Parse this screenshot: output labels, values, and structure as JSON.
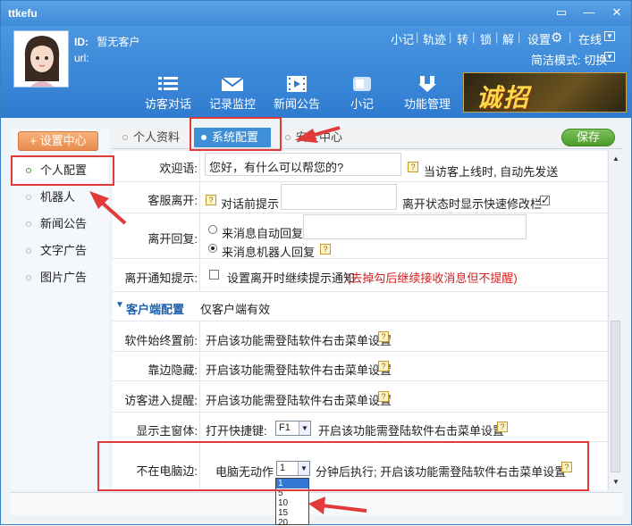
{
  "window": {
    "title": "ttkefu",
    "controls": [
      "▭",
      "—",
      "✕"
    ]
  },
  "header": {
    "id_label": "ID:",
    "id_value": "暂无客户",
    "url_label": "url:",
    "links": [
      "小记",
      "轨迹",
      "转",
      "锁",
      "解"
    ],
    "settings_label": "设置",
    "status_label": "在线",
    "mode_label": "简洁模式: 切换",
    "nav": [
      {
        "label": "访客对话",
        "icon": "list-icon"
      },
      {
        "label": "记录监控",
        "icon": "mail-icon"
      },
      {
        "label": "新闻公告",
        "icon": "film-icon"
      },
      {
        "label": "小记",
        "icon": "note-icon"
      },
      {
        "label": "功能管理",
        "icon": "download-icon"
      }
    ],
    "banner_text": "诚招"
  },
  "sidebar": {
    "center_button": "+ 设置中心",
    "items": [
      "个人配置",
      "机器人",
      "新闻公告",
      "文字广告",
      "图片广告"
    ],
    "active_index": 0
  },
  "tabs": {
    "items": [
      "个人资料",
      "系统配置",
      "安全中心"
    ],
    "active_index": 1,
    "save_label": "保存"
  },
  "content": {
    "welcome": {
      "label": "欢迎语:",
      "value": "您好，有什么可以帮您的?",
      "help": "当访客上线时, 自动先发送"
    },
    "service_leave": {
      "label": "客服离开:",
      "hint": "对话前提示",
      "offline_text": "离开状态时显示快速修改栏"
    },
    "leave_reply": {
      "label": "离开回复:",
      "option1": "来消息自动回复",
      "option2": "来消息机器人回复"
    },
    "leave_notice": {
      "label": "离开通知提示:",
      "text": "设置离开时继续提示通知",
      "red_text": "(去掉勾后继续接收消息但不提醒)"
    },
    "client_section": {
      "title": "客户端配置",
      "subtitle": "仅客户端有效"
    },
    "topmost": {
      "label": "软件始终置前:",
      "text": "开启该功能需登陆软件右击菜单设置"
    },
    "dock_hide": {
      "label": "靠边隐藏:",
      "text": "开启该功能需登陆软件右击菜单设置"
    },
    "visitor_remind": {
      "label": "访客进入提醒:",
      "text": "开启该功能需登陆软件右击菜单设置"
    },
    "show_main": {
      "label": "显示主窗体:",
      "prefix": "打开快捷键:",
      "key": "F1",
      "text": "开启该功能需登陆软件右击菜单设置"
    },
    "away": {
      "label": "不在电脑边:",
      "prefix": "电脑无动作",
      "value": "1",
      "suffix": "分钟后执行; 开启该功能需登陆软件右击菜单设置"
    },
    "dropdown_options": [
      "1",
      "5",
      "10",
      "15",
      "20"
    ]
  },
  "colors": {
    "titlebar": "#4a96e0",
    "accent_orange": "#e98b4f",
    "save_green": "#4a9a2a",
    "annotation_red": "#e03a3a"
  }
}
